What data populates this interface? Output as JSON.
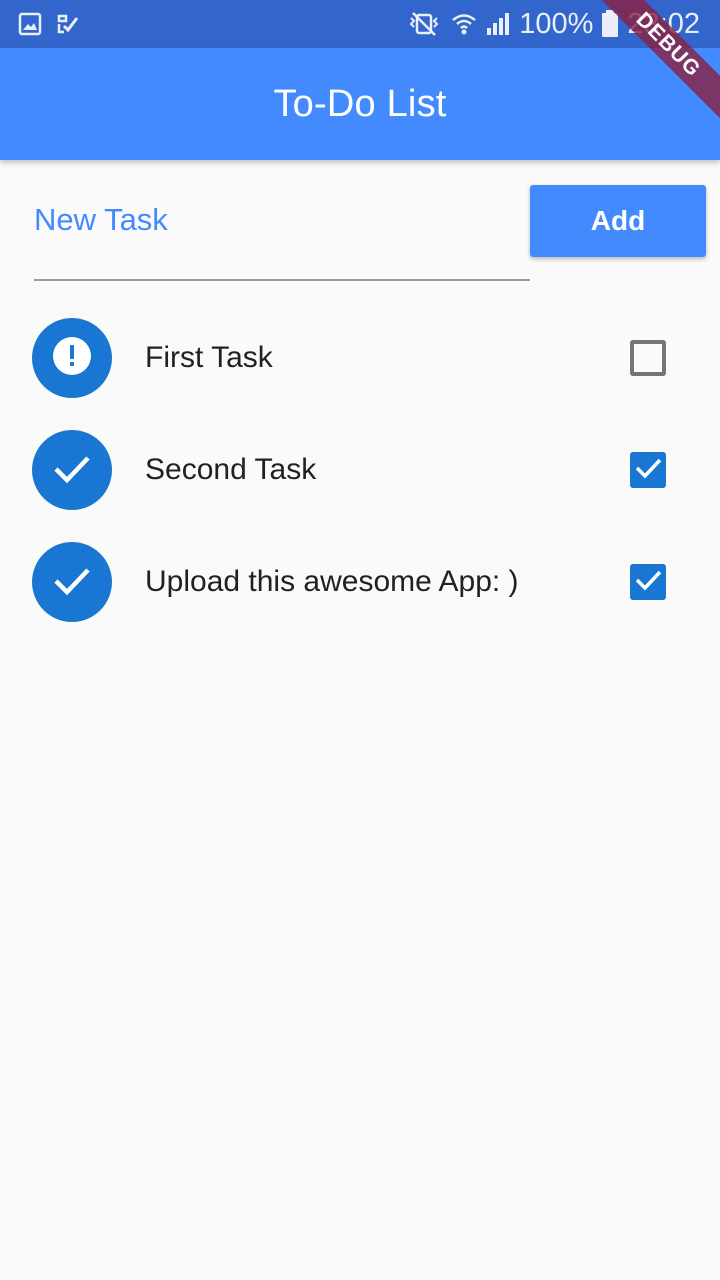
{
  "status_bar": {
    "battery": "100%",
    "time": "23:02",
    "icons": [
      "gallery-icon",
      "task-check-icon",
      "vibrate-off-icon",
      "wifi-icon",
      "signal-icon",
      "battery-icon"
    ]
  },
  "app_bar": {
    "title": "To-Do List",
    "color": "#448aff"
  },
  "debug_banner": "DEBUG",
  "new_task": {
    "placeholder": "New Task",
    "value": ""
  },
  "add_button": {
    "label": "Add"
  },
  "tasks": [
    {
      "title": "First Task",
      "done": false,
      "icon": "alert-icon"
    },
    {
      "title": "Second Task",
      "done": true,
      "icon": "check-icon"
    },
    {
      "title": "Upload this awesome App: )",
      "done": true,
      "icon": "check-icon"
    }
  ]
}
